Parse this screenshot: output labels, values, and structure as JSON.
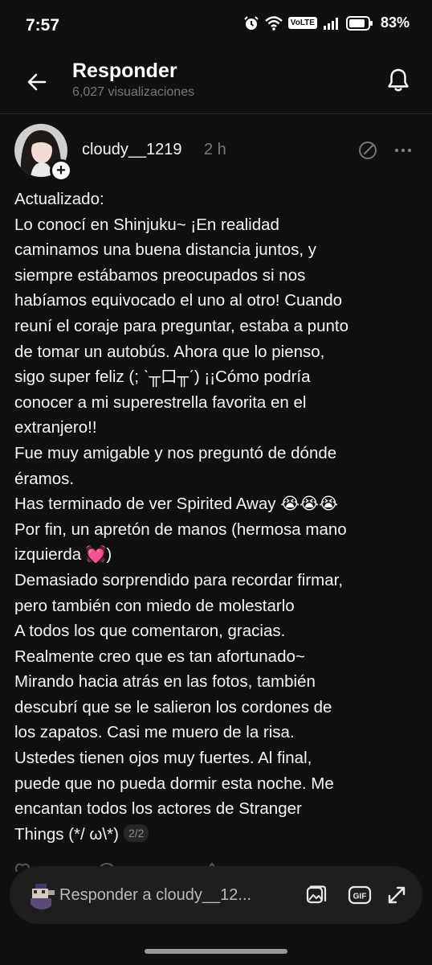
{
  "status_bar": {
    "time": "7:57",
    "network_label": "VoLTE",
    "battery_percent": "83%"
  },
  "header": {
    "title": "Responder",
    "views": "6,027 visualizaciones"
  },
  "post": {
    "username": "cloudy__1219",
    "timestamp": "2 h",
    "lines": [
      "Actualizado:",
      "Lo conocí en Shinjuku~ ¡En realidad",
      "caminamos una buena distancia juntos, y",
      "siempre estábamos preocupados si nos",
      "habíamos equivocado el uno al otro! Cuando",
      "reuní el coraje para preguntar, estaba a punto",
      "de tomar un autobús. Ahora que lo pienso,",
      "sigo super feliz (; ˋ╥口╥ˊ) ¡¡Cómo podría",
      "conocer a mi superestrella favorita en el",
      "extranjero!!",
      "Fue muy amigable y nos preguntó de dónde",
      "éramos.",
      "Has terminado de ver Spirited Away 😭😭😭",
      "Por fin, un apretón de manos (hermosa mano",
      "izquierda 💓)",
      "Demasiado sorprendido para recordar firmar,",
      "pero también con miedo de molestarlo",
      "A todos los que comentaron, gracias.",
      "Realmente creo que es tan afortunado~",
      "Mirando hacia atrás en las fotos, también",
      "descubrí que se le salieron los cordones de",
      "los zapatos. Casi me muero de la risa.",
      "Ustedes tienen ojos muy fuertes. Al final,",
      "puede que no pueda dormir esta noche. Me",
      "encantan todos los actores de Stranger",
      "Things (*/ ω\\*)"
    ],
    "page_indicator": "2/2"
  },
  "reply_bar": {
    "placeholder": "Responder a cloudy__12..."
  },
  "icons": {
    "back": "back-arrow-icon",
    "bell": "bell-icon",
    "follow": "plus-icon",
    "edited": "edit-icon",
    "more": "more-icon",
    "image": "image-icon",
    "gif": "gif-icon",
    "expand": "expand-icon"
  }
}
